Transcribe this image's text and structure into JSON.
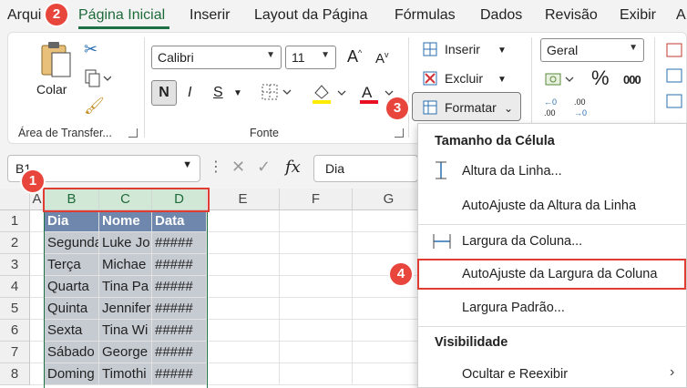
{
  "menu_tabs": [
    "Arqui",
    "Página Inicial",
    "Inserir",
    "Layout da Página",
    "Fórmulas",
    "Dados",
    "Revisão",
    "Exibir",
    "A"
  ],
  "ribbon": {
    "clipboard": {
      "paste_label": "Colar",
      "group_label": "Área de Transfer..."
    },
    "font": {
      "font_name": "Calibri",
      "font_size": "11",
      "group_label": "Fonte",
      "bold": "N",
      "italic": "I",
      "underline": "S"
    },
    "cells": {
      "insert_label": "Inserir",
      "delete_label": "Excluir",
      "format_label": "Formatar"
    },
    "number": {
      "format_value": "Geral",
      "percent": "%",
      "comma": "000"
    }
  },
  "formula_bar": {
    "name_box": "B1",
    "content": "Dia",
    "fx": "fx"
  },
  "columns": [
    "A",
    "B",
    "C",
    "D",
    "E",
    "F",
    "G"
  ],
  "rows": [
    {
      "n": "1",
      "b": "Dia",
      "c": "Nome",
      "d": "Data"
    },
    {
      "n": "2",
      "b": "Segunda",
      "c": "Luke Jo",
      "d": "#####"
    },
    {
      "n": "3",
      "b": "Terça",
      "c": "Michae",
      "d": "#####"
    },
    {
      "n": "4",
      "b": "Quarta",
      "c": "Tina Pa",
      "d": "#####"
    },
    {
      "n": "5",
      "b": "Quinta",
      "c": "Jennifer",
      "d": "#####"
    },
    {
      "n": "6",
      "b": "Sexta",
      "c": "Tina Wi",
      "d": "#####"
    },
    {
      "n": "7",
      "b": "Sábado",
      "c": "George",
      "d": "#####"
    },
    {
      "n": "8",
      "b": "Doming",
      "c": "Timothi",
      "d": "#####"
    }
  ],
  "format_menu": {
    "section1": "Tamanho da Célula",
    "item_row_height": "Altura da Linha...",
    "item_autofit_row": "AutoAjuste da Altura da Linha",
    "item_col_width": "Largura da Coluna...",
    "item_autofit_col": "AutoAjuste da Largura da Coluna",
    "item_default_width": "Largura Padrão...",
    "section2": "Visibilidade",
    "item_hide": "Ocultar e Reexibir"
  },
  "callouts": [
    "1",
    "2",
    "3",
    "4"
  ],
  "colors": {
    "accent": "#1e7145",
    "callout": "#e8453c",
    "table_header": "#6f87ad",
    "selection": "#c6cbd2"
  }
}
